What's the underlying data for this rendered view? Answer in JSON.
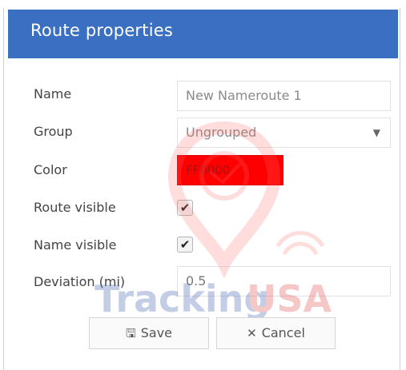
{
  "dialog": {
    "title": "Route properties"
  },
  "form": {
    "name_label": "Name",
    "name_value": "New  Nameroute 1",
    "group_label": "Group",
    "group_value": "Ungrouped",
    "color_label": "Color",
    "color_value": "FF0000",
    "route_visible_label": "Route visible",
    "route_visible_checked": true,
    "name_visible_label": "Name visible",
    "name_visible_checked": true,
    "deviation_label": "Deviation (mi)",
    "deviation_value": "0.5"
  },
  "buttons": {
    "save_label": "Save",
    "cancel_label": "Cancel"
  },
  "watermark": {
    "text_tracking": "Tracking",
    "text_usa": "USA"
  },
  "colors": {
    "title_bar": "#3a6fc1",
    "color_swatch": "#fe0000"
  },
  "icons": {
    "dropdown": "chevron-down-icon",
    "checkbox": "checkmark-icon",
    "save": "floppy-disk-icon",
    "cancel": "close-icon"
  }
}
